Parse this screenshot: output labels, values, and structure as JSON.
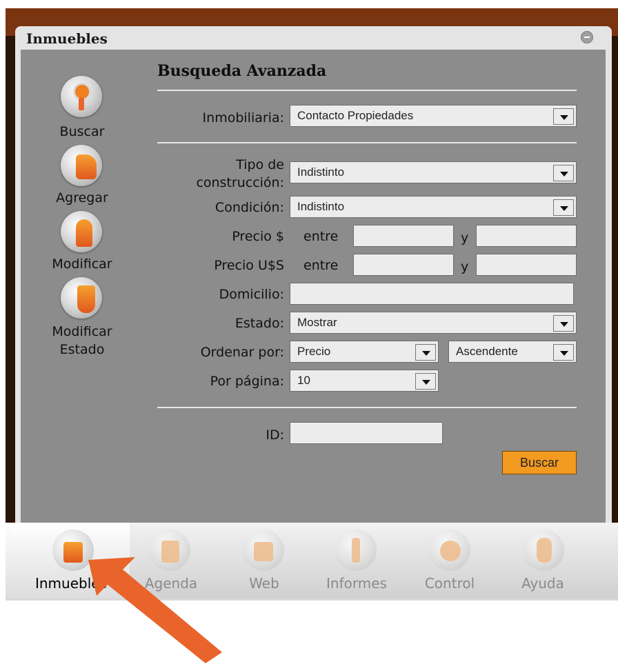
{
  "window": {
    "title": "Inmuebles"
  },
  "nav": {
    "buscar": "Buscar",
    "agregar": "Agregar",
    "modificar": "Modificar",
    "modificar_estado_1": "Modificar",
    "modificar_estado_2": "Estado"
  },
  "form": {
    "title": "Busqueda Avanzada",
    "inmobiliaria_label": "Inmobiliaria:",
    "inmobiliaria_value": "Contacto Propiedades",
    "tipo_label_1": "Tipo de",
    "tipo_label_2": "construcción:",
    "tipo_value": "Indistinto",
    "condicion_label": "Condición:",
    "condicion_value": "Indistinto",
    "precio_pesos_label": "Precio $",
    "precio_usd_label": "Precio U$S",
    "entre": "entre",
    "y": "y",
    "domicilio_label": "Domicilio:",
    "estado_label": "Estado:",
    "estado_value": "Mostrar",
    "ordenar_label": "Ordenar por:",
    "ordenar_value": "Precio",
    "orden_dir_value": "Ascendente",
    "por_pagina_label": "Por página:",
    "por_pagina_value": "10",
    "id_label": "ID:",
    "buscar_button": "Buscar"
  },
  "dock": {
    "inmuebles": "Inmuebles",
    "agenda": "Agenda",
    "web": "Web",
    "informes": "Informes",
    "control": "Control",
    "ayuda": "Ayuda"
  },
  "colors": {
    "accent": "#f39a20",
    "arrow": "#e8642a",
    "panel": "#8c8c8c"
  },
  "icons": [
    "search-icon",
    "add-icon",
    "edit-icon",
    "status-icon",
    "home-icon",
    "agenda-icon",
    "web-icon",
    "info-icon",
    "control-icon",
    "help-icon",
    "arrow-annotation-icon"
  ]
}
